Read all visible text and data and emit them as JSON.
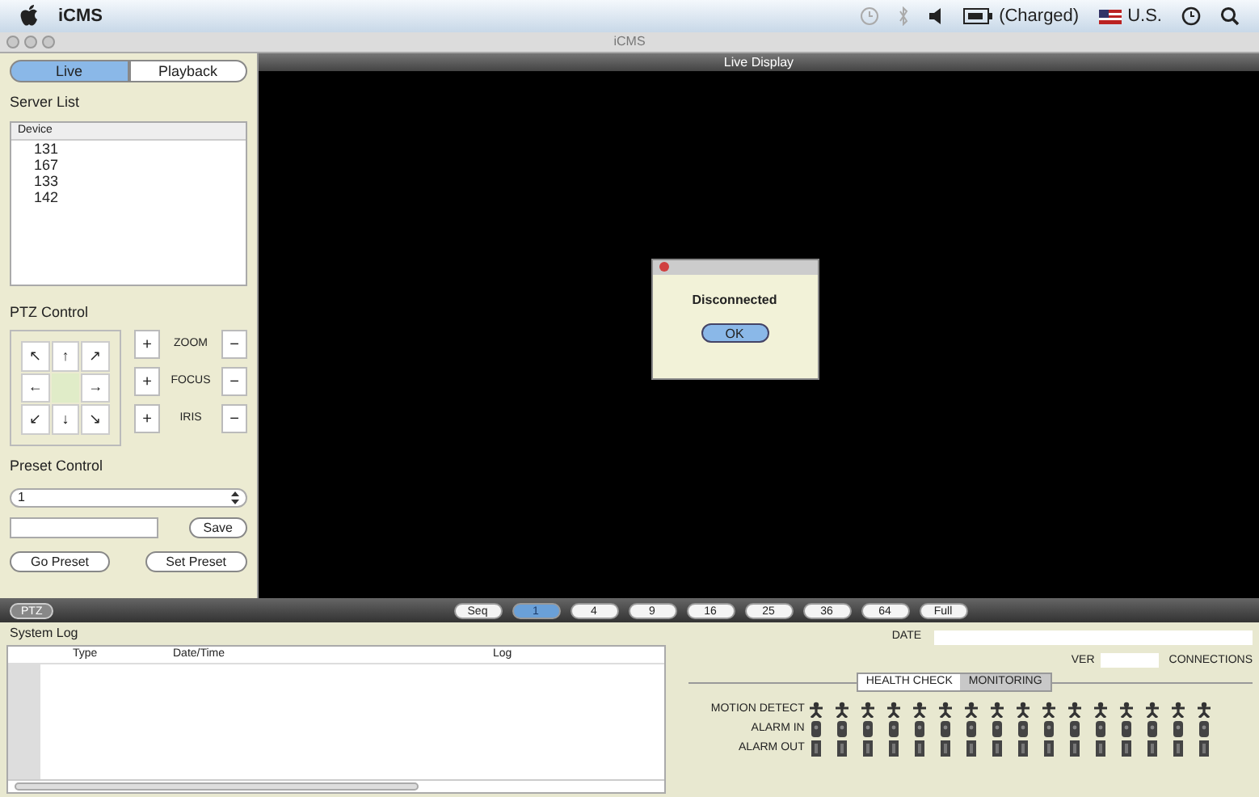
{
  "menu_bar": {
    "app_name": "iCMS",
    "battery": "(Charged)",
    "input_source": "U.S."
  },
  "window": {
    "title": "iCMS"
  },
  "mode_tabs": [
    {
      "label": "Live",
      "selected": true
    },
    {
      "label": "Playback",
      "selected": false
    }
  ],
  "server_list": {
    "title": "Server List",
    "column": "Device",
    "devices": [
      "131",
      "167",
      "133",
      "142"
    ]
  },
  "ptz_control": {
    "title": "PTZ Control",
    "arrows": [
      "↖",
      "↑",
      "↗",
      "←",
      "",
      "→",
      "↙",
      "↓",
      "↘"
    ],
    "adjust": [
      {
        "label": "ZOOM",
        "plus": "+",
        "minus": "−"
      },
      {
        "label": "FOCUS",
        "plus": "+",
        "minus": "−"
      },
      {
        "label": "IRIS",
        "plus": "+",
        "minus": "−"
      }
    ]
  },
  "preset_control": {
    "title": "Preset Control",
    "selected_preset": "1",
    "save": "Save",
    "go": "Go Preset",
    "set": "Set Preset"
  },
  "live_display": {
    "title": "Live Display"
  },
  "dialog": {
    "message": "Disconnected",
    "button": "OK"
  },
  "toolbar": {
    "ptz": "PTZ",
    "layouts": [
      {
        "label": "Seq",
        "selected": false
      },
      {
        "label": "1",
        "selected": true
      },
      {
        "label": "4",
        "selected": false
      },
      {
        "label": "9",
        "selected": false
      },
      {
        "label": "16",
        "selected": false
      },
      {
        "label": "25",
        "selected": false
      },
      {
        "label": "36",
        "selected": false
      },
      {
        "label": "64",
        "selected": false
      },
      {
        "label": "Full",
        "selected": false
      }
    ]
  },
  "system_log": {
    "title": "System Log",
    "columns": [
      "Type",
      "Date/Time",
      "Log"
    ]
  },
  "status": {
    "date_label": "DATE",
    "ver_label": "VER",
    "connections_label": "CONNECTIONS",
    "tabs": [
      {
        "label": "HEALTH CHECK",
        "selected": false
      },
      {
        "label": "MONITORING",
        "selected": true
      }
    ],
    "rows": [
      {
        "label": "MOTION DETECT",
        "kind": "motion"
      },
      {
        "label": "ALARM IN",
        "kind": "alarm_in"
      },
      {
        "label": "ALARM OUT",
        "kind": "alarm_out"
      }
    ]
  }
}
